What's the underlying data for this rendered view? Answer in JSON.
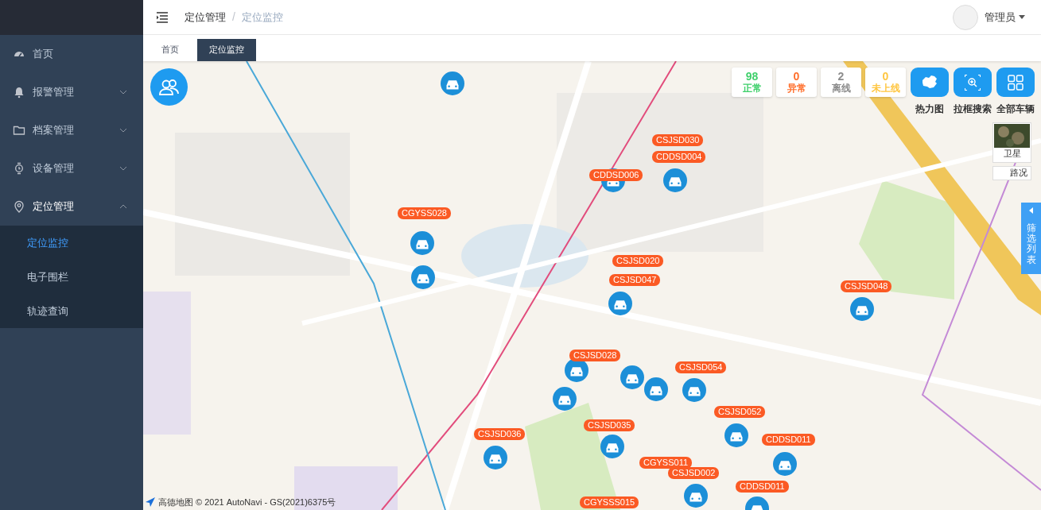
{
  "header": {
    "breadcrumb": [
      "定位管理",
      "定位监控"
    ],
    "breadcrumb_separator": "/",
    "user": "管理员"
  },
  "sidebar": {
    "items": [
      {
        "label": "首页",
        "kind": "dashboard",
        "submenu": false,
        "expanded": false
      },
      {
        "label": "报警管理",
        "kind": "bell",
        "expanded": false
      },
      {
        "label": "档案管理",
        "kind": "folder",
        "expanded": false
      },
      {
        "label": "设备管理",
        "kind": "watch",
        "expanded": false
      },
      {
        "label": "定位管理",
        "kind": "pin",
        "expanded": true,
        "children": [
          {
            "label": "定位监控",
            "selected": true
          },
          {
            "label": "电子围栏",
            "selected": false
          },
          {
            "label": "轨迹查询",
            "selected": false
          }
        ]
      }
    ]
  },
  "tabs": [
    {
      "label": "首页",
      "selected": false
    },
    {
      "label": "定位监控",
      "selected": true
    }
  ],
  "stats": [
    {
      "value": "98",
      "label": "正常",
      "color": "#3fd06b"
    },
    {
      "value": "0",
      "label": "异常",
      "color": "#ff6f2c"
    },
    {
      "value": "2",
      "label": "离线",
      "color": "#8c8c8c"
    },
    {
      "value": "0",
      "label": "未上线",
      "color": "#ffc640"
    }
  ],
  "tools": [
    {
      "label": "热力图",
      "kind": "map"
    },
    {
      "label": "拉框搜索",
      "kind": "zoom"
    },
    {
      "label": "全部车辆",
      "kind": "grid"
    }
  ],
  "layers": [
    {
      "label": "卫星",
      "kind": "satellite"
    },
    {
      "label": "路况",
      "kind": "traffic"
    }
  ],
  "filter_panel": {
    "label": "筛选列表"
  },
  "markers": [
    {
      "label": "CSJSD030"
    },
    {
      "label": "CDDSD004"
    },
    {
      "label": "CDDSD006"
    },
    {
      "label": "CGYSS028"
    },
    {
      "label": "CSJSD020"
    },
    {
      "label": "CSJSD047"
    },
    {
      "label": "CSJSD048"
    },
    {
      "label": "CSJSD028"
    },
    {
      "label": "CSJSD054"
    },
    {
      "label": "CSJSD052"
    },
    {
      "label": "CSJSD036"
    },
    {
      "label": "CSJSD035"
    },
    {
      "label": "CDDSD011"
    },
    {
      "label": "CGYSS011"
    },
    {
      "label": "CSJSD002"
    },
    {
      "label": "CDDSD011"
    },
    {
      "label": "CGYSSS015"
    }
  ],
  "attribution": "高德地图 © 2021 AutoNavi - GS(2021)6375号"
}
